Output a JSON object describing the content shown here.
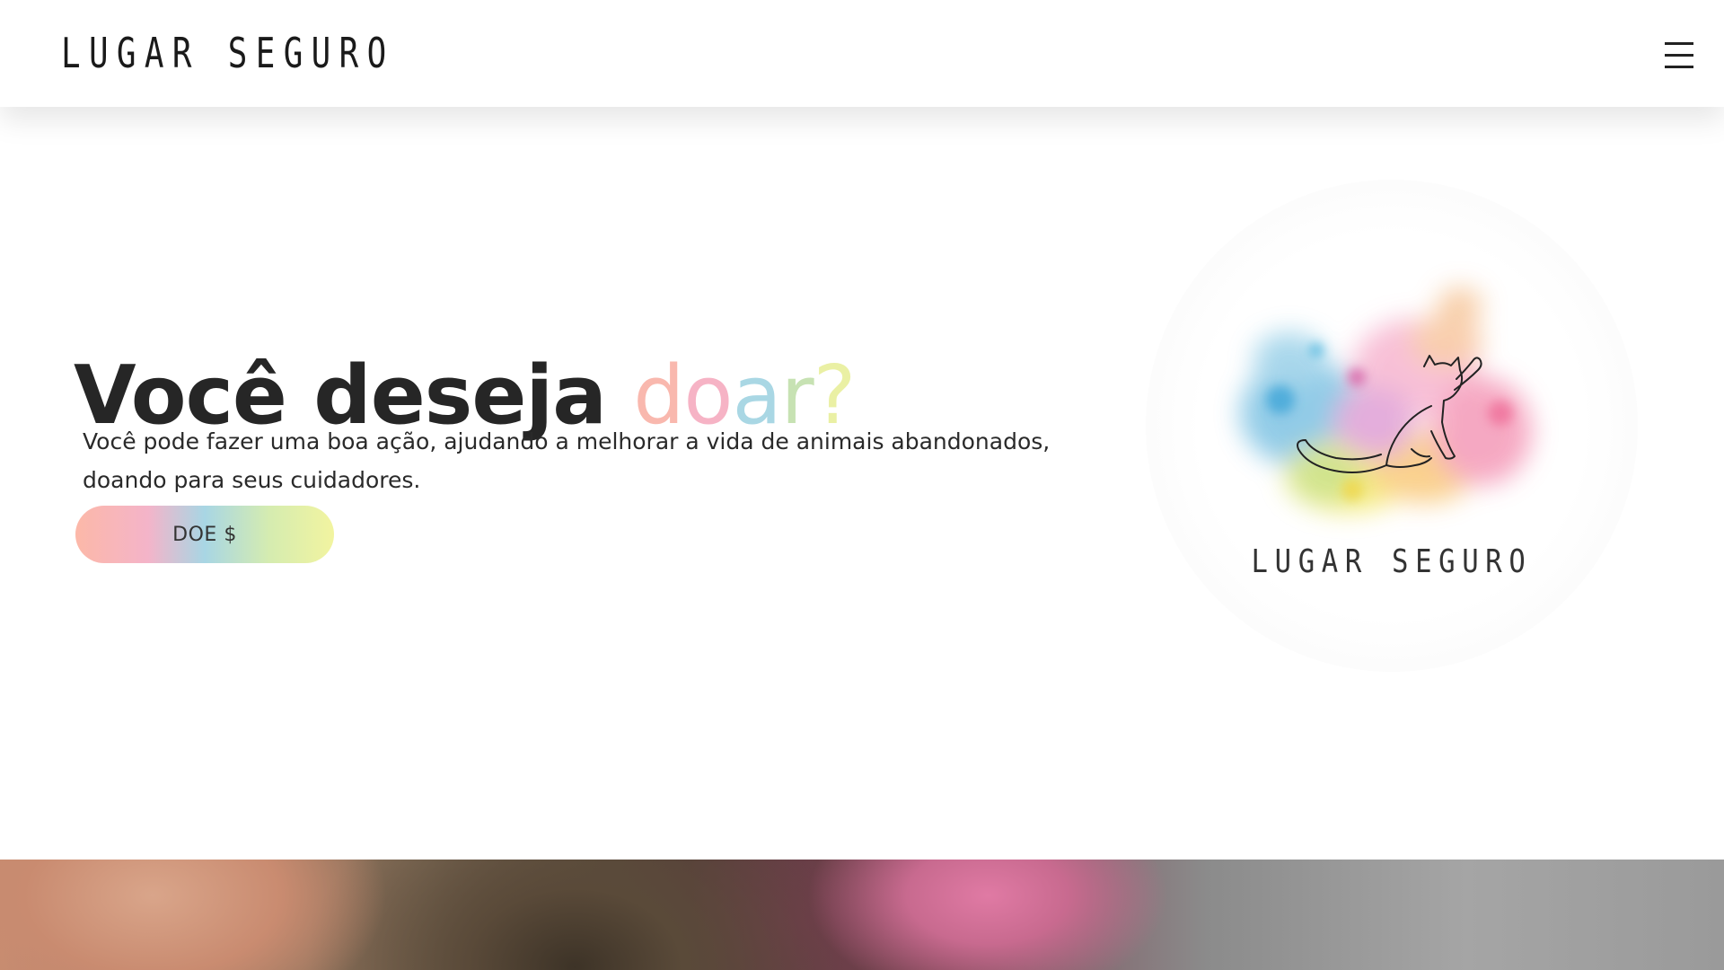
{
  "header": {
    "logo_text": "LUGAR SEGURO",
    "menu_icon": "hamburger-menu-icon"
  },
  "hero": {
    "title_prefix": "Você deseja ",
    "title_highlight": [
      "d",
      "o",
      "a",
      "r",
      "?"
    ],
    "description": "Você pode fazer uma boa ação, ajudando a melhorar a vida de animais abandonados, doando para seus cuidadores.",
    "donate_label": "DOE $"
  },
  "brand_image": {
    "label": "LUGAR SEGURO",
    "icon": "watercolor-cat-icon"
  },
  "colors": {
    "pastel_peach": "#f9b8ae",
    "pastel_pink": "#f6b3c5",
    "pastel_blue": "#a9d7e4",
    "pastel_green": "#c7e2b3",
    "pastel_yellow": "#eaf0a4",
    "text_dark": "#262626"
  }
}
